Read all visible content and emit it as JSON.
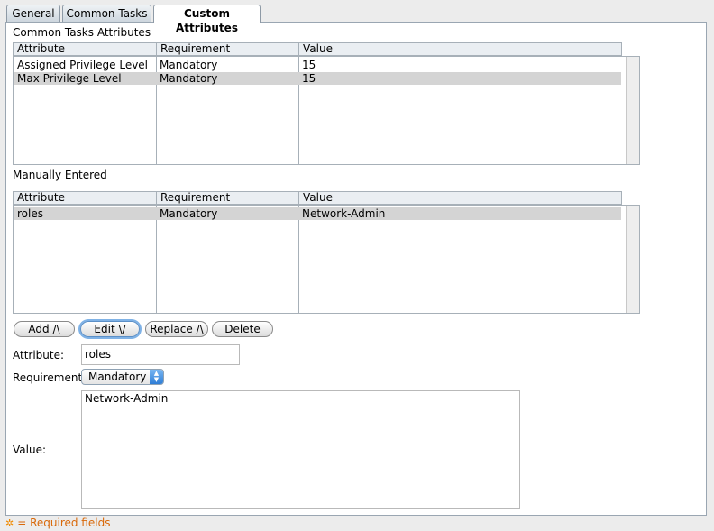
{
  "tabs": [
    {
      "label": "General"
    },
    {
      "label": "Common Tasks"
    },
    {
      "label": "Custom Attributes"
    }
  ],
  "common_section": {
    "title": "Common Tasks Attributes",
    "columns": [
      "Attribute",
      "Requirement",
      "Value"
    ],
    "rows": [
      {
        "attribute": "Assigned Privilege Level",
        "requirement": "Mandatory",
        "value": "15"
      },
      {
        "attribute": "Max Privilege Level",
        "requirement": "Mandatory",
        "value": "15"
      }
    ]
  },
  "manual_section": {
    "title": "Manually Entered",
    "columns": [
      "Attribute",
      "Requirement",
      "Value"
    ],
    "rows": [
      {
        "attribute": "roles",
        "requirement": "Mandatory",
        "value": "Network-Admin"
      }
    ]
  },
  "buttons": {
    "add": "Add /\\",
    "edit": "Edit \\/",
    "replace": "Replace /\\",
    "delete": "Delete"
  },
  "form": {
    "attribute_label": "Attribute:",
    "attribute_value": "roles",
    "requirement_label": "Requirement:",
    "requirement_value": "Mandatory",
    "value_label": "Value:",
    "value_text": "Network-Admin"
  },
  "footer": {
    "required_note": "= Required fields"
  },
  "colors": {
    "required": "#d9690a",
    "selected_row": "#d4d4d4"
  }
}
